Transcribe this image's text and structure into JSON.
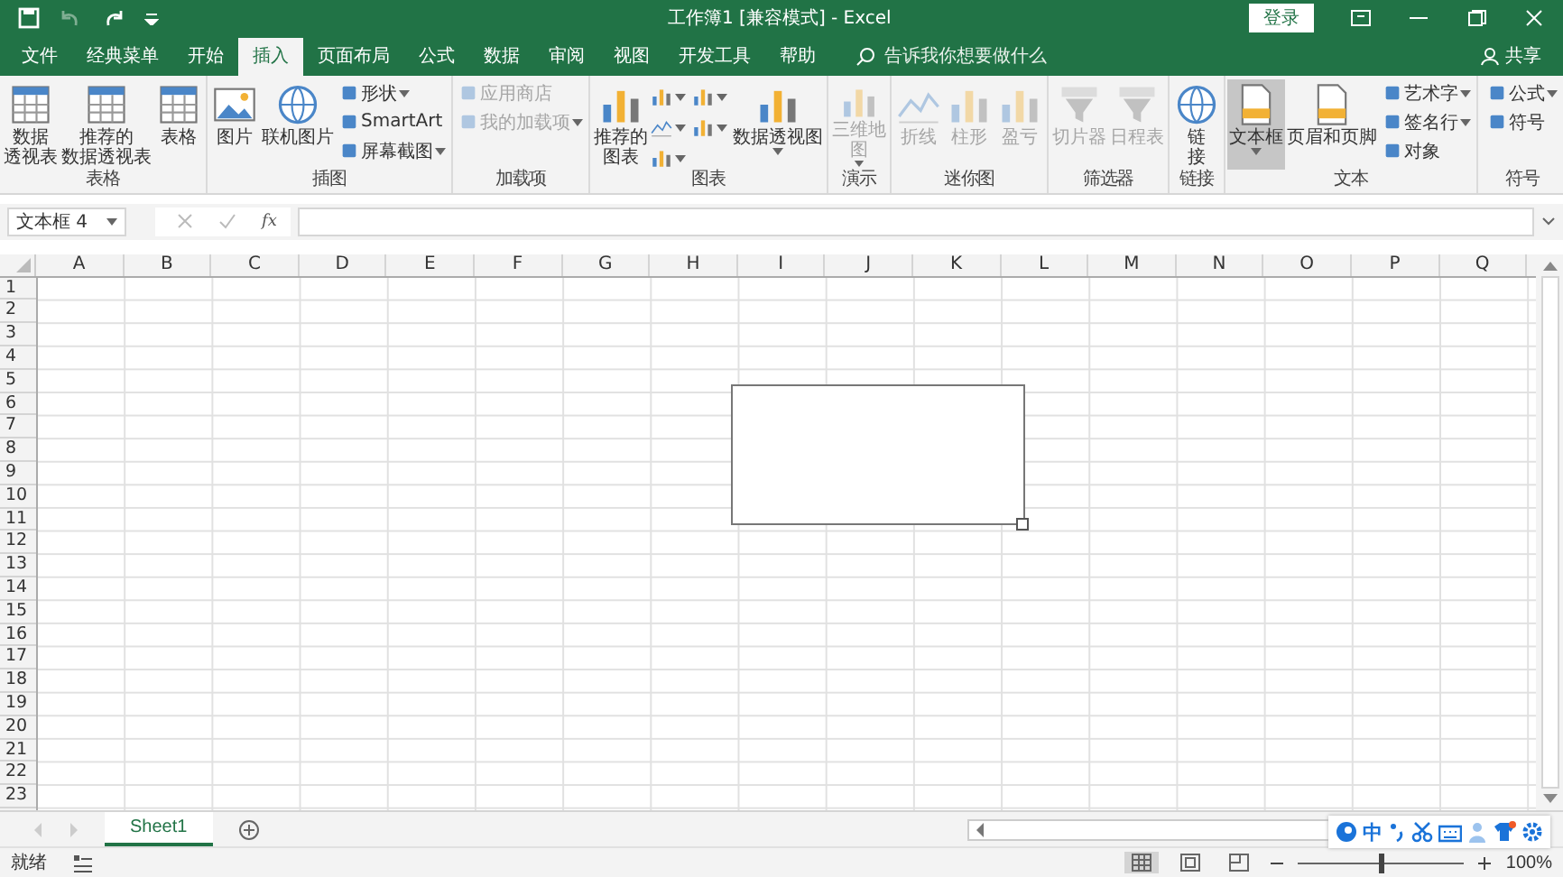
{
  "title_bar": {
    "title": "工作簿1 [兼容模式] - Excel",
    "login_button": "登录"
  },
  "tabs": [
    {
      "label": "文件",
      "selected": false
    },
    {
      "label": "经典菜单",
      "selected": false
    },
    {
      "label": "开始",
      "selected": false
    },
    {
      "label": "插入",
      "selected": true
    },
    {
      "label": "页面布局",
      "selected": false
    },
    {
      "label": "公式",
      "selected": false
    },
    {
      "label": "数据",
      "selected": false
    },
    {
      "label": "审阅",
      "selected": false
    },
    {
      "label": "视图",
      "selected": false
    },
    {
      "label": "开发工具",
      "selected": false
    },
    {
      "label": "帮助",
      "selected": false
    }
  ],
  "search": {
    "placeholder": "告诉我你想要做什么"
  },
  "share_button": "共享",
  "ribbon_groups": [
    {
      "label": "表格",
      "buttons": [
        {
          "kind": "large",
          "lines": [
            "数据",
            "透视表"
          ],
          "disabled": false,
          "selected": false,
          "dropdown": false
        },
        {
          "kind": "large",
          "lines": [
            "推荐的",
            "数据透视表"
          ],
          "disabled": false,
          "selected": false,
          "dropdown": false
        },
        {
          "kind": "large",
          "lines": [
            "表格"
          ],
          "disabled": false,
          "selected": false,
          "dropdown": false
        }
      ]
    },
    {
      "label": "插图",
      "buttons": [
        {
          "kind": "large",
          "lines": [
            "图片"
          ],
          "disabled": false,
          "selected": false,
          "dropdown": false
        },
        {
          "kind": "large",
          "lines": [
            "联机图片"
          ],
          "disabled": false,
          "selected": false,
          "dropdown": false
        },
        {
          "kind": "small",
          "lines": [
            "形状"
          ],
          "disabled": false,
          "selected": false,
          "dropdown": true
        },
        {
          "kind": "small",
          "lines": [
            "SmartArt"
          ],
          "disabled": false,
          "selected": false,
          "dropdown": false
        },
        {
          "kind": "small",
          "lines": [
            "屏幕截图"
          ],
          "disabled": false,
          "selected": false,
          "dropdown": true
        }
      ]
    },
    {
      "label": "加载项",
      "buttons": [
        {
          "kind": "small",
          "lines": [
            "应用商店"
          ],
          "disabled": true,
          "selected": false,
          "dropdown": false
        },
        {
          "kind": "small",
          "lines": [
            "我的加载项"
          ],
          "disabled": true,
          "selected": false,
          "dropdown": true
        }
      ]
    },
    {
      "label": "图表",
      "buttons": [
        {
          "kind": "large",
          "lines": [
            "推荐的",
            "图表"
          ],
          "disabled": false,
          "selected": false,
          "dropdown": false
        },
        {
          "kind": "iconpair",
          "disabled": false,
          "selected": false,
          "dropdown": true
        },
        {
          "kind": "large",
          "lines": [
            "数据透视图"
          ],
          "disabled": false,
          "selected": false,
          "dropdown": true
        }
      ]
    },
    {
      "label": "演示",
      "buttons": [
        {
          "kind": "large",
          "lines": [
            "三维地",
            "图"
          ],
          "disabled": true,
          "selected": false,
          "dropdown": true
        }
      ]
    },
    {
      "label": "迷你图",
      "buttons": [
        {
          "kind": "large",
          "lines": [
            "折线"
          ],
          "disabled": true,
          "selected": false,
          "dropdown": false
        },
        {
          "kind": "large",
          "lines": [
            "柱形"
          ],
          "disabled": true,
          "selected": false,
          "dropdown": false
        },
        {
          "kind": "large",
          "lines": [
            "盈亏"
          ],
          "disabled": true,
          "selected": false,
          "dropdown": false
        }
      ]
    },
    {
      "label": "筛选器",
      "buttons": [
        {
          "kind": "large",
          "lines": [
            "切片器"
          ],
          "disabled": true,
          "selected": false,
          "dropdown": false
        },
        {
          "kind": "large",
          "lines": [
            "日程表"
          ],
          "disabled": true,
          "selected": false,
          "dropdown": false
        }
      ]
    },
    {
      "label": "链接",
      "buttons": [
        {
          "kind": "large",
          "lines": [
            "链",
            "接"
          ],
          "disabled": false,
          "selected": false,
          "dropdown": false
        }
      ]
    },
    {
      "label": "文本",
      "buttons": [
        {
          "kind": "large",
          "lines": [
            "文本框"
          ],
          "disabled": false,
          "selected": true,
          "dropdown": true
        },
        {
          "kind": "large",
          "lines": [
            "页眉和页脚"
          ],
          "disabled": false,
          "selected": false,
          "dropdown": false
        },
        {
          "kind": "small",
          "lines": [
            "艺术字"
          ],
          "disabled": false,
          "selected": false,
          "dropdown": true
        },
        {
          "kind": "small",
          "lines": [
            "签名行"
          ],
          "disabled": false,
          "selected": false,
          "dropdown": true
        },
        {
          "kind": "small",
          "lines": [
            "对象"
          ],
          "disabled": false,
          "selected": false,
          "dropdown": false
        }
      ]
    },
    {
      "label": "符号",
      "buttons": [
        {
          "kind": "small",
          "lines": [
            "公式"
          ],
          "disabled": false,
          "selected": false,
          "dropdown": true
        },
        {
          "kind": "small",
          "lines": [
            "符号"
          ],
          "disabled": false,
          "selected": false,
          "dropdown": false
        }
      ]
    }
  ],
  "formula_bar": {
    "name_box": "文本框 4",
    "function_label": "fx"
  },
  "columns": [
    "A",
    "B",
    "C",
    "D",
    "E",
    "F",
    "G",
    "H",
    "I",
    "J",
    "K",
    "L",
    "M",
    "N",
    "O",
    "P",
    "Q"
  ],
  "rows": [
    "1",
    "2",
    "3",
    "4",
    "5",
    "6",
    "7",
    "8",
    "9",
    "10",
    "11",
    "12",
    "13",
    "14",
    "15",
    "16",
    "17",
    "18",
    "19",
    "20",
    "21",
    "22",
    "23"
  ],
  "sheet_tabs": [
    {
      "label": "Sheet1",
      "selected": true
    }
  ],
  "status_bar": {
    "status": "就绪",
    "views": [
      {
        "selected": true
      },
      {
        "selected": false
      },
      {
        "selected": false
      }
    ],
    "zoom_slider": {
      "level": 0.5
    },
    "zoom": "100%"
  },
  "ime_toolbar": {
    "mode": "中"
  }
}
